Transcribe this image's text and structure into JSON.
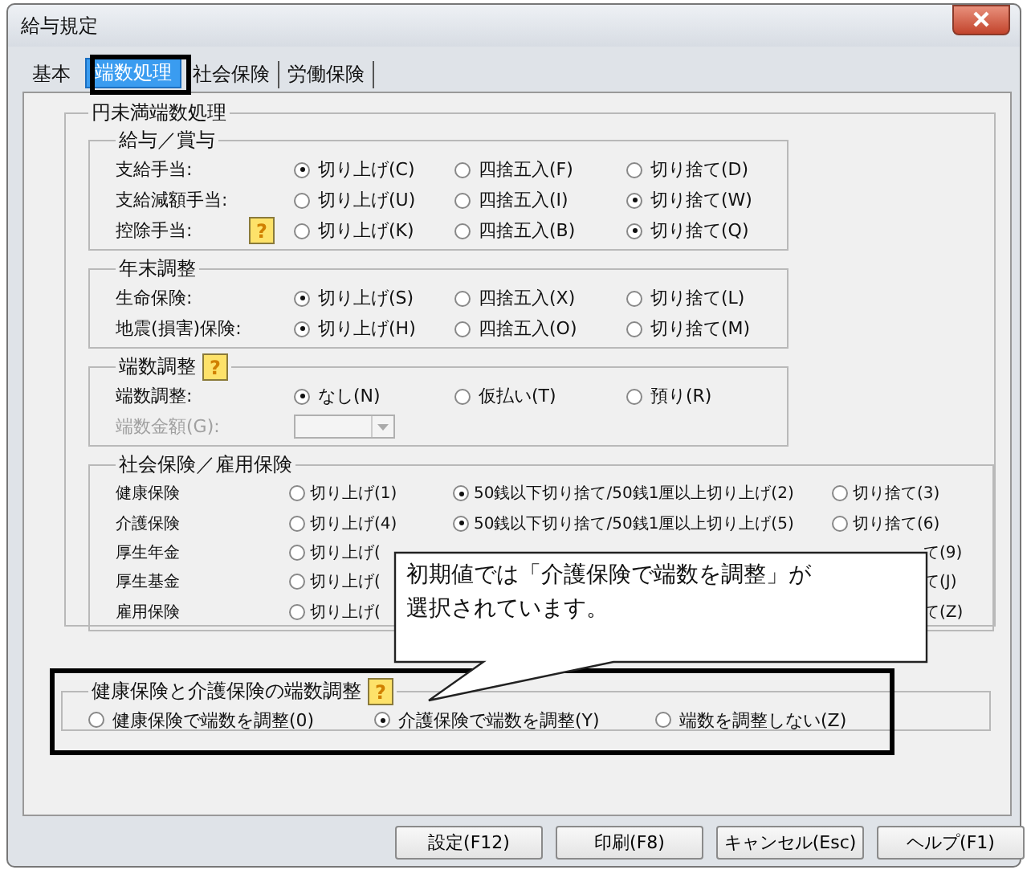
{
  "window": {
    "title": "給与規定"
  },
  "tabs": [
    {
      "label": "基本",
      "selected": false
    },
    {
      "label": "端数処理",
      "selected": true
    },
    {
      "label": "社会保険",
      "selected": false
    },
    {
      "label": "労働保険",
      "selected": false
    }
  ],
  "panel": {
    "title": "円未満端数処理",
    "sections": [
      {
        "title": "給与／賞与",
        "kind": "narrow",
        "rows": [
          {
            "kind": "radio",
            "label": "支給手当:",
            "options": [
              {
                "label": "切り上げ(C)",
                "selected": true
              },
              {
                "label": "四捨五入(F)",
                "selected": false
              },
              {
                "label": "切り捨て(D)",
                "selected": false
              }
            ]
          },
          {
            "kind": "radio",
            "label": "支給減額手当:",
            "options": [
              {
                "label": "切り上げ(U)",
                "selected": false
              },
              {
                "label": "四捨五入(I)",
                "selected": false
              },
              {
                "label": "切り捨て(W)",
                "selected": true
              }
            ]
          },
          {
            "kind": "radio",
            "label": "控除手当:",
            "help": "?",
            "options": [
              {
                "label": "切り上げ(K)",
                "selected": false
              },
              {
                "label": "四捨五入(B)",
                "selected": false
              },
              {
                "label": "切り捨て(Q)",
                "selected": true
              }
            ]
          }
        ]
      },
      {
        "title": "年末調整",
        "kind": "narrow",
        "rows": [
          {
            "kind": "radio",
            "label": "生命保険:",
            "options": [
              {
                "label": "切り上げ(S)",
                "selected": true
              },
              {
                "label": "四捨五入(X)",
                "selected": false
              },
              {
                "label": "切り捨て(L)",
                "selected": false
              }
            ]
          },
          {
            "kind": "radio",
            "label": "地震(損害)保険:",
            "options": [
              {
                "label": "切り上げ(H)",
                "selected": true
              },
              {
                "label": "四捨五入(O)",
                "selected": false
              },
              {
                "label": "切り捨て(M)",
                "selected": false
              }
            ]
          }
        ]
      },
      {
        "title": "端数調整",
        "help": "?",
        "kind": "narrow",
        "rows": [
          {
            "kind": "radio",
            "label": "端数調整:",
            "options": [
              {
                "label": "なし(N)",
                "selected": true
              },
              {
                "label": "仮払い(T)",
                "selected": false
              },
              {
                "label": "預り(R)",
                "selected": false
              }
            ]
          },
          {
            "kind": "dropdown",
            "label": "端数金額(G):",
            "disabled": true
          }
        ]
      },
      {
        "title": "社会保険／雇用保険",
        "kind": "wide",
        "rows": [
          {
            "kind": "radio",
            "label": "健康保険",
            "options": [
              {
                "kind": "radio",
                "label": "切り上げ(1)",
                "selected": false
              },
              {
                "kind": "radio",
                "label": "50銭以下切り捨て/50銭1厘以上切り上げ(2)",
                "selected": true
              },
              {
                "kind": "radio",
                "label": "切り捨て(3)",
                "selected": false
              }
            ]
          },
          {
            "kind": "radio",
            "label": "介護保険",
            "options": [
              {
                "kind": "radio",
                "label": "切り上げ(4)",
                "selected": false
              },
              {
                "kind": "radio",
                "label": "50銭以下切り捨て/50銭1厘以上切り上げ(5)",
                "selected": true
              },
              {
                "kind": "radio",
                "label": "切り捨て(6)",
                "selected": false
              }
            ]
          },
          {
            "kind": "radio",
            "label": "厚生年金",
            "options": [
              {
                "kind": "radio",
                "label": "切り上げ(",
                "selected": false
              },
              {
                "kind": "cut",
                "label": "て(9)"
              }
            ]
          },
          {
            "kind": "radio",
            "label": "厚生基金",
            "options": [
              {
                "kind": "radio",
                "label": "切り上げ(",
                "selected": false
              },
              {
                "kind": "cut",
                "label": "て(J)"
              }
            ]
          },
          {
            "kind": "radio",
            "label": "雇用保険",
            "options": [
              {
                "kind": "radio",
                "label": "切り上げ(",
                "selected": false
              },
              {
                "kind": "cut",
                "label": "て(Z)"
              }
            ]
          }
        ]
      }
    ]
  },
  "adjustment": {
    "title": "健康保険と介護保険の端数調整",
    "help": "?",
    "options": [
      {
        "label": "健康保険で端数を調整(0)",
        "selected": false
      },
      {
        "label": "介護保険で端数を調整(Y)",
        "selected": true
      },
      {
        "label": "端数を調整しない(Z)",
        "selected": false
      }
    ]
  },
  "callout": {
    "text": "初期値では「介護保険で端数を調整」が選択されています。"
  },
  "buttons": [
    "設定(F12)",
    "印刷(F8)",
    "キャンセル(Esc)",
    "ヘルプ(F1)"
  ]
}
